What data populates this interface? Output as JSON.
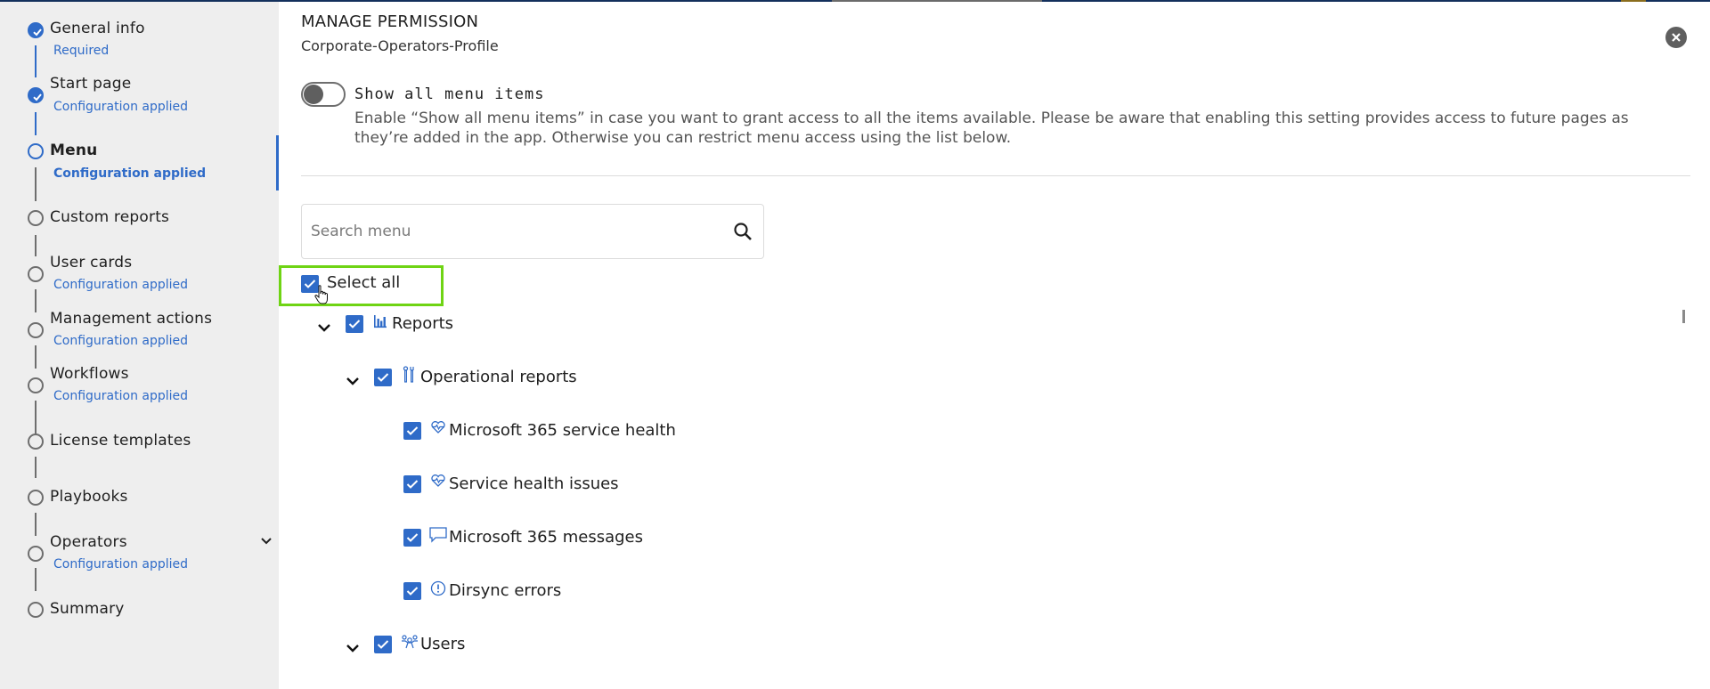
{
  "wizard": {
    "steps": [
      {
        "title": "General info",
        "status": "Required",
        "state": "done"
      },
      {
        "title": "Start page",
        "status": "Configuration applied",
        "state": "done"
      },
      {
        "title": "Menu",
        "status": "Configuration applied",
        "state": "current"
      },
      {
        "title": "Custom reports",
        "status": "",
        "state": "pending"
      },
      {
        "title": "User cards",
        "status": "Configuration applied",
        "state": "pending"
      },
      {
        "title": "Management actions",
        "status": "Configuration applied",
        "state": "pending"
      },
      {
        "title": "Workflows",
        "status": "Configuration applied",
        "state": "pending"
      },
      {
        "title": "License templates",
        "status": "",
        "state": "pending"
      },
      {
        "title": "Playbooks",
        "status": "",
        "state": "pending"
      },
      {
        "title": "Operators",
        "status": "Configuration applied",
        "state": "pending",
        "expandable": true
      },
      {
        "title": "Summary",
        "status": "",
        "state": "pending"
      }
    ]
  },
  "panel": {
    "title": "MANAGE PERMISSION",
    "subtitle": "Corporate-Operators-Profile",
    "close_icon": "close-circle-icon",
    "toggle": {
      "label": "Show all menu items",
      "on": false,
      "description": "Enable “Show all menu items” in case you want to grant access to all the items available. Please be aware that enabling this setting provides access to future pages as they’re added in the app. Otherwise you can restrict menu access using the list below."
    },
    "search": {
      "placeholder": "Search menu",
      "value": "",
      "icon": "search-icon"
    },
    "select_all": {
      "label": "Select all",
      "checked": true
    },
    "tree": [
      {
        "label": "Reports",
        "icon": "bar-chart-icon",
        "checked": true,
        "expanded": true,
        "level": 0
      },
      {
        "label": "Operational reports",
        "icon": "tools-icon",
        "checked": true,
        "expanded": true,
        "level": 1
      },
      {
        "label": "Microsoft 365 service health",
        "icon": "heart-pulse-icon",
        "checked": true,
        "level": 2
      },
      {
        "label": "Service health issues",
        "icon": "heart-pulse-icon",
        "checked": true,
        "level": 2
      },
      {
        "label": "Microsoft 365 messages",
        "icon": "chat-icon",
        "checked": true,
        "level": 2
      },
      {
        "label": "Dirsync errors",
        "icon": "alert-circle-icon",
        "checked": true,
        "level": 2
      },
      {
        "label": "Users",
        "icon": "users-icon",
        "checked": true,
        "expanded": true,
        "level": 1
      }
    ]
  },
  "colors": {
    "accent": "#2f6bc8",
    "highlight": "#6fd414",
    "sidebar_bg": "#eeeeee",
    "topbar": "#13305c"
  }
}
